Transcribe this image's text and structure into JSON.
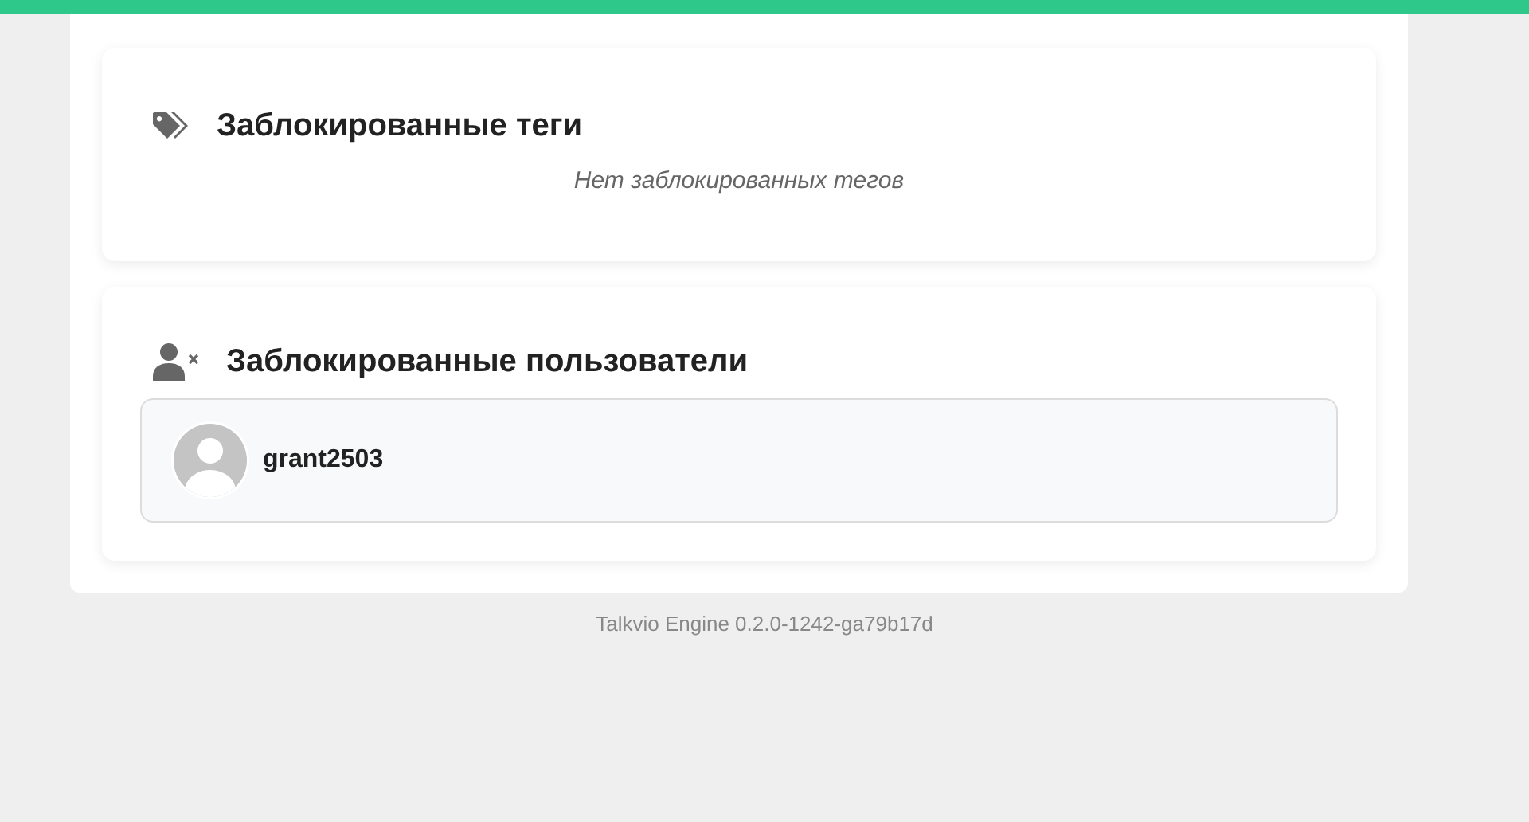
{
  "blocked_tags": {
    "title": "Заблокированные теги",
    "empty_text": "Нет заблокированных тегов"
  },
  "blocked_users": {
    "title": "Заблокированные пользователи",
    "users": [
      {
        "username": "grant2503"
      }
    ]
  },
  "footer": {
    "version": "Talkvio Engine 0.2.0-1242-ga79b17d"
  }
}
